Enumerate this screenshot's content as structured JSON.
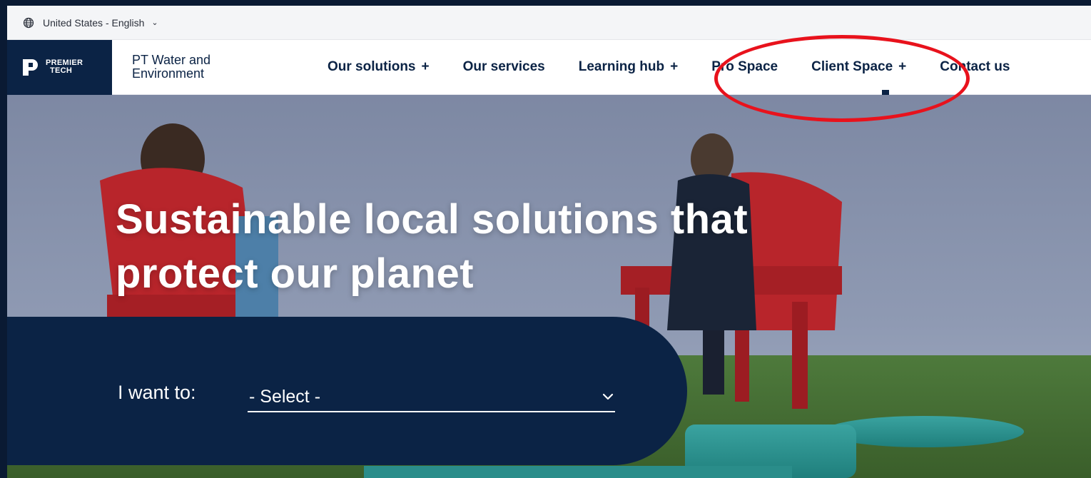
{
  "locale": {
    "label": "United States - English"
  },
  "header": {
    "logo_line1": "PREMIER",
    "logo_line2": "TECH",
    "division": "PT Water and Environment",
    "nav": [
      {
        "label": "Our solutions",
        "plus": "+"
      },
      {
        "label": "Our services",
        "plus": ""
      },
      {
        "label": "Learning hub",
        "plus": "+"
      },
      {
        "label": "Pro Space",
        "plus": ""
      },
      {
        "label": "Client Space",
        "plus": "+"
      },
      {
        "label": "Contact us",
        "plus": ""
      }
    ]
  },
  "hero": {
    "title": "Sustainable local solutions that protect our planet",
    "selector_label": "I want to:",
    "selector_value": "- Select -"
  },
  "colors": {
    "brand_navy": "#0b2345",
    "annotation_red": "#e8121c"
  },
  "icons": {
    "globe": "globe-icon",
    "chevron": "chevron-down-icon",
    "logo": "premier-tech-logo-mark"
  }
}
